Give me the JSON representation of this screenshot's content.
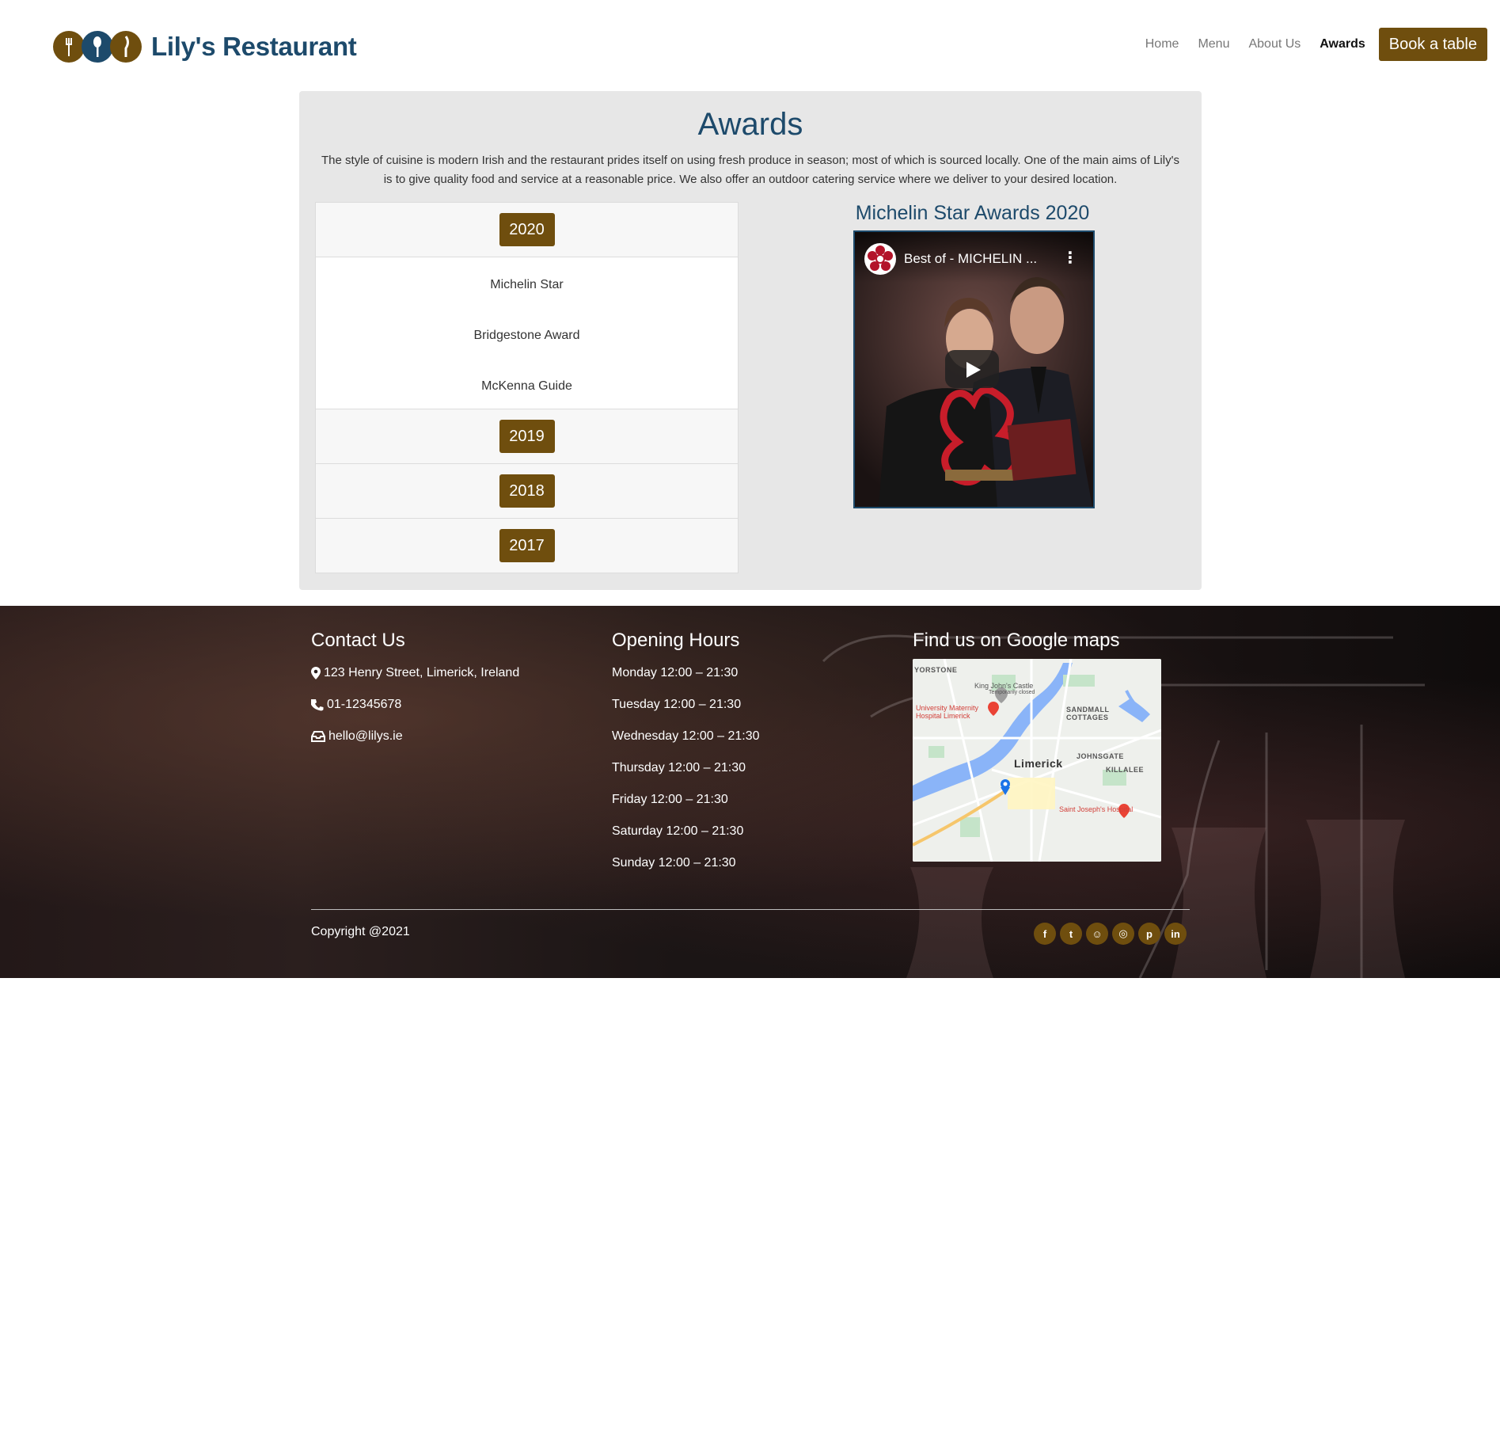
{
  "header": {
    "brand": "Lily's Restaurant",
    "nav": [
      {
        "label": "Home"
      },
      {
        "label": "Menu"
      },
      {
        "label": "About Us"
      },
      {
        "label": "Awards"
      }
    ],
    "cta": "Book a table"
  },
  "awards": {
    "title": "Awards",
    "description": "The style of cuisine is modern Irish and the restaurant prides itself on using fresh produce in season; most of which is sourced locally. One of the main aims of Lily's is to give quality food and service at a reasonable price. We also offer an outdoor catering service where we deliver to your desired location.",
    "years": [
      {
        "year": "2020",
        "expanded": true,
        "items": [
          "Michelin Star",
          "Bridgestone Award",
          "McKenna Guide"
        ]
      },
      {
        "year": "2019",
        "expanded": false
      },
      {
        "year": "2018",
        "expanded": false
      },
      {
        "year": "2017",
        "expanded": false
      }
    ],
    "video": {
      "heading": "Michelin Star Awards 2020",
      "caption": "Best of - MICHELIN ...",
      "more_icon": "more-vert-icon",
      "play_icon": "play-icon"
    }
  },
  "footer": {
    "contact": {
      "title": "Contact Us",
      "address": "123 Henry Street, Limerick, Ireland",
      "phone": "01-12345678",
      "email": "hello@lilys.ie"
    },
    "hours": {
      "title": "Opening Hours",
      "days": [
        "Monday 12:00 – 21:30",
        "Tuesday 12:00 – 21:30",
        "Wednesday 12:00 – 21:30",
        "Thursday 12:00 – 21:30",
        "Friday 12:00 – 21:30",
        "Saturday 12:00 – 21:30",
        "Sunday 12:00 – 21:30"
      ]
    },
    "map": {
      "title": "Find us on Google maps",
      "labels": {
        "city": "Limerick",
        "castle": "King John's Castle",
        "castle_note": "Temporarily closed",
        "hospital1": "University Maternity Hospital Limerick",
        "hospital2": "Saint Joseph's Hospital",
        "area1": "SANDMALL COTTAGES",
        "area2": "JOHNSGATE",
        "area3": "KILLALEE",
        "area4": "YORSTONE"
      }
    },
    "copyright": "Copyright @2021",
    "socials": [
      {
        "icon": "facebook-icon",
        "glyph": "f"
      },
      {
        "icon": "twitter-icon",
        "glyph": "t"
      },
      {
        "icon": "snapchat-icon",
        "glyph": "☺"
      },
      {
        "icon": "instagram-icon",
        "glyph": "◎"
      },
      {
        "icon": "pinterest-icon",
        "glyph": "p"
      },
      {
        "icon": "linkedin-icon",
        "glyph": "in"
      }
    ]
  },
  "colors": {
    "brand_brown": "#6f4e0e",
    "brand_blue": "#1d4a6b"
  }
}
